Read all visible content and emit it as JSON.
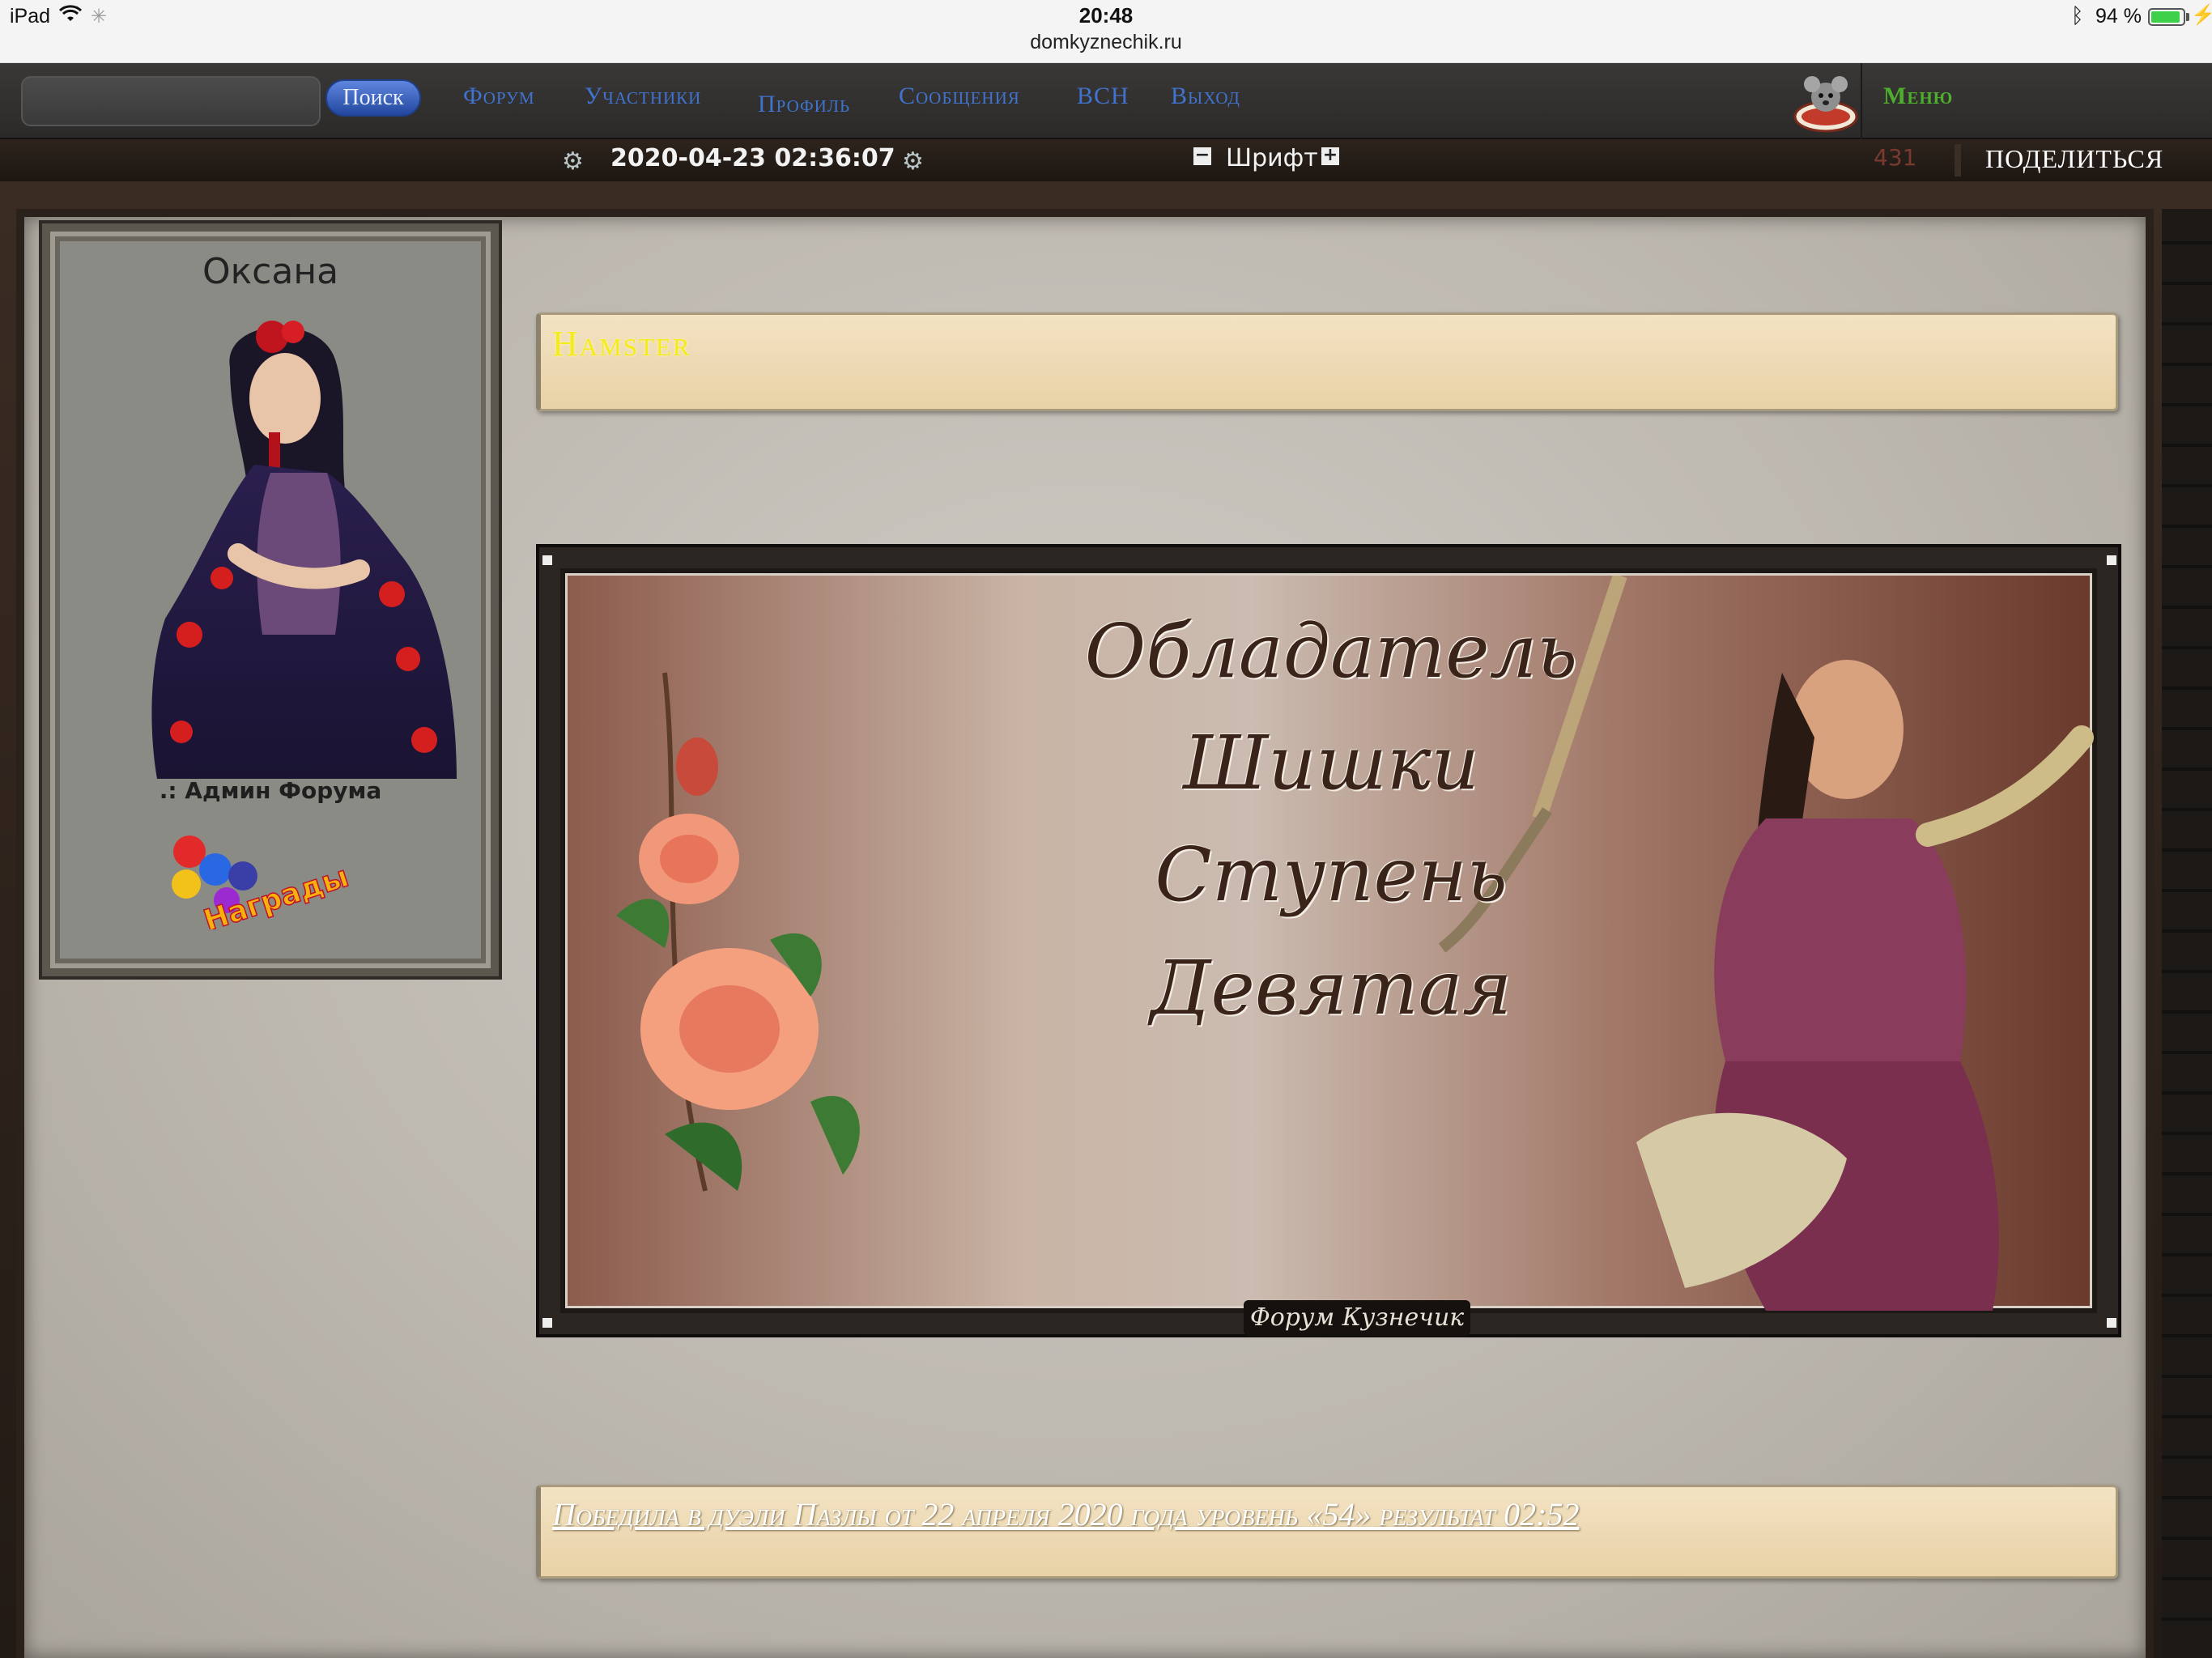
{
  "status_bar": {
    "device": "iPad",
    "time": "20:48",
    "domain": "domkyznechik.ru",
    "battery": "94 %"
  },
  "navbar": {
    "search_placeholder": "",
    "search_button": "Поиск",
    "items": [
      "Форум",
      "Участники",
      "Профиль",
      "Сообщения",
      "ВСН",
      "Выход"
    ],
    "menu": "Меню",
    "logo_icon": "mouse-logo-icon"
  },
  "subbar": {
    "datetime": "2020-04-23 02:36:07",
    "font_label": "Шрифт",
    "font_minus": "−",
    "font_plus": "+",
    "counter": "431",
    "share": "ПОДЕЛИТЬСЯ"
  },
  "profile": {
    "name": "Оксана",
    "role": ".: Админ Форума",
    "awards_badge": "Награды"
  },
  "post": {
    "signature_title": "Hamster",
    "banner_lines": [
      "Обладатель",
      "Шишки",
      "Ступень",
      "Девятая"
    ],
    "banner_signature": "Форум Кузнечик",
    "victory_link": "Победила в дуэли Пазлы от 22 апреля 2020 года уровень «54» результат 02:52"
  },
  "colors": {
    "nav_link": "#3f73cf",
    "menu_green": "#4dae2e",
    "signature_yellow": "#f4ec1a",
    "quote_box": "#f3e2c3"
  }
}
